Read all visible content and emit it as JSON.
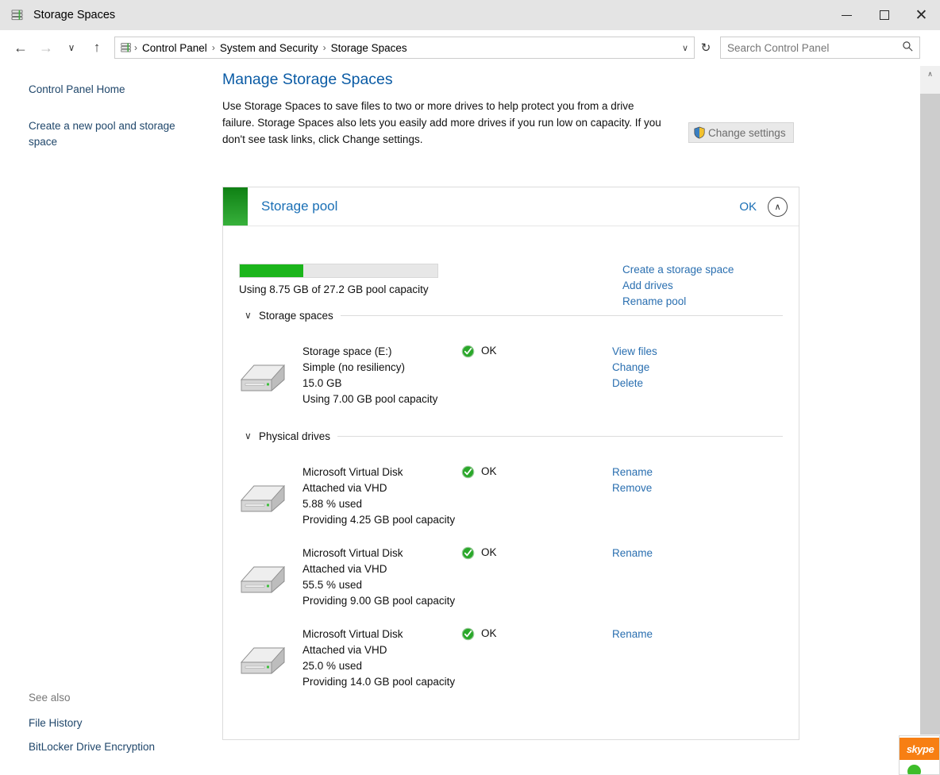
{
  "window": {
    "title": "Storage Spaces",
    "icon": "storage-spaces-icon",
    "minimize_label": "—",
    "maximize_label": "",
    "close_label": "✕"
  },
  "addressbar": {
    "back_glyph": "←",
    "forward_glyph": "→",
    "recent_glyph": "∨",
    "up_glyph": "↑",
    "breadcrumbs": [
      "Control Panel",
      "System and Security",
      "Storage Spaces"
    ],
    "separator": "›",
    "dropdown_glyph": "∨",
    "refresh_glyph": "↻"
  },
  "search": {
    "placeholder": "Search Control Panel",
    "value": "",
    "icon": "search-icon"
  },
  "sidebar": {
    "home_label": "Control Panel Home",
    "create_label": "Create a new pool and storage space",
    "see_also_label": "See also",
    "see_also_links": [
      "File History",
      "BitLocker Drive Encryption"
    ]
  },
  "main": {
    "page_title": "Manage Storage Spaces",
    "intro": "Use Storage Spaces to save files to two or more drives to help protect you from a drive failure. Storage Spaces also lets you easily add more drives if you run low on capacity. If you don't see task links, click Change settings.",
    "change_settings_label": "Change settings"
  },
  "pool": {
    "name": "Storage pool",
    "status": "OK",
    "collapse_glyph": "∧",
    "capacity_text": "Using 8.75 GB of 27.2 GB pool capacity",
    "capacity_used_gb": 8.75,
    "capacity_total_gb": 27.2,
    "capacity_percent": 32,
    "tasks": [
      "Create a storage space",
      "Add drives",
      "Rename pool"
    ]
  },
  "storage_spaces_group": {
    "title": "Storage spaces",
    "chevron": "∨",
    "items": [
      {
        "name": "Storage space (E:)",
        "resiliency": "Simple (no resiliency)",
        "size": "15.0 GB",
        "usage": "Using 7.00 GB pool capacity",
        "status": "OK",
        "actions": [
          "View files",
          "Change",
          "Delete"
        ]
      }
    ]
  },
  "physical_drives_group": {
    "title": "Physical drives",
    "chevron": "∨",
    "items": [
      {
        "name": "Microsoft Virtual Disk",
        "attachment": "Attached via VHD",
        "used": "5.88 % used",
        "providing": "Providing 4.25 GB pool capacity",
        "status": "OK",
        "actions": [
          "Rename",
          "Remove"
        ]
      },
      {
        "name": "Microsoft Virtual Disk",
        "attachment": "Attached via VHD",
        "used": "55.5 % used",
        "providing": "Providing 9.00 GB pool capacity",
        "status": "OK",
        "actions": [
          "Rename"
        ]
      },
      {
        "name": "Microsoft Virtual Disk",
        "attachment": "Attached via VHD",
        "used": "25.0 % used",
        "providing": "Providing 14.0 GB pool capacity",
        "status": "OK",
        "actions": [
          "Rename"
        ]
      }
    ]
  },
  "scrollbar": {
    "up_glyph": "∧",
    "down_glyph": "∨"
  },
  "skype_overlay": {
    "label": "skype"
  },
  "colors": {
    "accent_blue": "#0a5ba5",
    "link_blue": "#2a6fb0",
    "pool_green": "#1bb51b",
    "status_green": "#2aa82a",
    "skype_orange": "#f77f13"
  }
}
